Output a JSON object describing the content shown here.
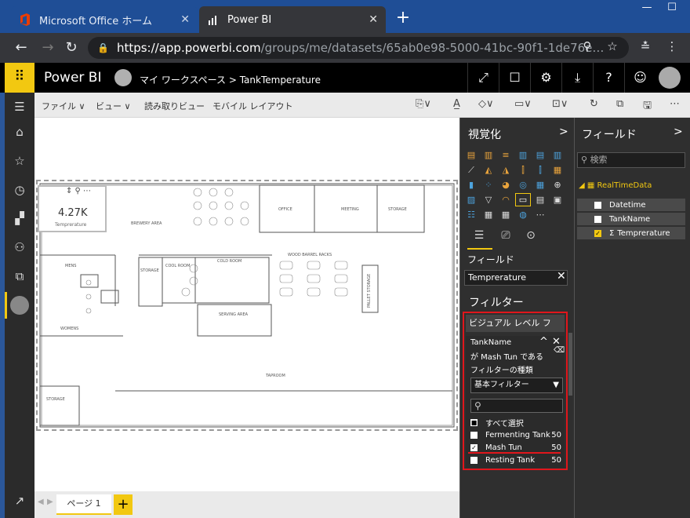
{
  "browser": {
    "tabs": [
      {
        "label": "Microsoft Office ホーム",
        "close": "✕"
      },
      {
        "label": "Power BI",
        "close": "✕"
      }
    ],
    "new_tab": "+",
    "window_buttons": [
      "—",
      "☐"
    ],
    "url_host": "https://app.powerbi.com",
    "url_path": "/groups/me/datasets/65ab0e98-5000-41bc-90f1-1de76e…"
  },
  "pbi": {
    "app_name": "Power BI",
    "breadcrumb": "マイ ワークスペース > TankTemperature"
  },
  "toolbar": {
    "file": "ファイル ∨",
    "view": "ビュー ∨",
    "reading_view": "読み取りビュー",
    "mobile_layout": "モバイル レイアウト"
  },
  "card": {
    "value": "4.27K",
    "label": "Temprerature"
  },
  "floorplan": {
    "rooms": {
      "brewery": "BREWERY AREA",
      "office": "OFFICE",
      "meeting": "MEETING",
      "storage_top": "STORAGE",
      "mens": "MENS",
      "womens": "WOMENS",
      "storage_mid": "STORAGE",
      "cool_room": "COOL ROOM",
      "cold_room": "COLD ROOM",
      "wood_barrel": "WOOD BARREL RACKS",
      "pallet_storage": "PALLET STORAGE",
      "serving": "SERVING AREA",
      "taproom": "TAPROOM",
      "storage_bottom": "STORAGE"
    }
  },
  "pages": {
    "tab1": "ページ 1",
    "add": "+"
  },
  "viz_pane": {
    "title": "視覚化",
    "chevron": ">",
    "fields_label": "フィールド",
    "field_well_value": "Temprerature",
    "filters_title": "フィルター",
    "visual_level": "ビジュアル レベル フィ...",
    "filter_field": "TankName",
    "filter_condition": "が Mash Tun である",
    "filter_type_label": "フィルターの種類",
    "filter_type_value": "基本フィルター",
    "select_all": "すべて選択",
    "items": [
      {
        "name": "Fermenting Tank",
        "count": "50",
        "checked": false
      },
      {
        "name": "Mash Tun",
        "count": "50",
        "checked": true
      },
      {
        "name": "Resting Tank",
        "count": "50",
        "checked": false
      }
    ]
  },
  "fields_pane": {
    "title": "フィールド",
    "chevron": ">",
    "search_placeholder": "検索",
    "table": "RealTimeData",
    "fields": [
      {
        "name": "Datetime",
        "checked": false
      },
      {
        "name": "TankName",
        "checked": false
      },
      {
        "name": "Temprerature",
        "checked": true
      }
    ]
  },
  "colors": {
    "accent": "#f2c811",
    "highlight": "#e0161c"
  }
}
